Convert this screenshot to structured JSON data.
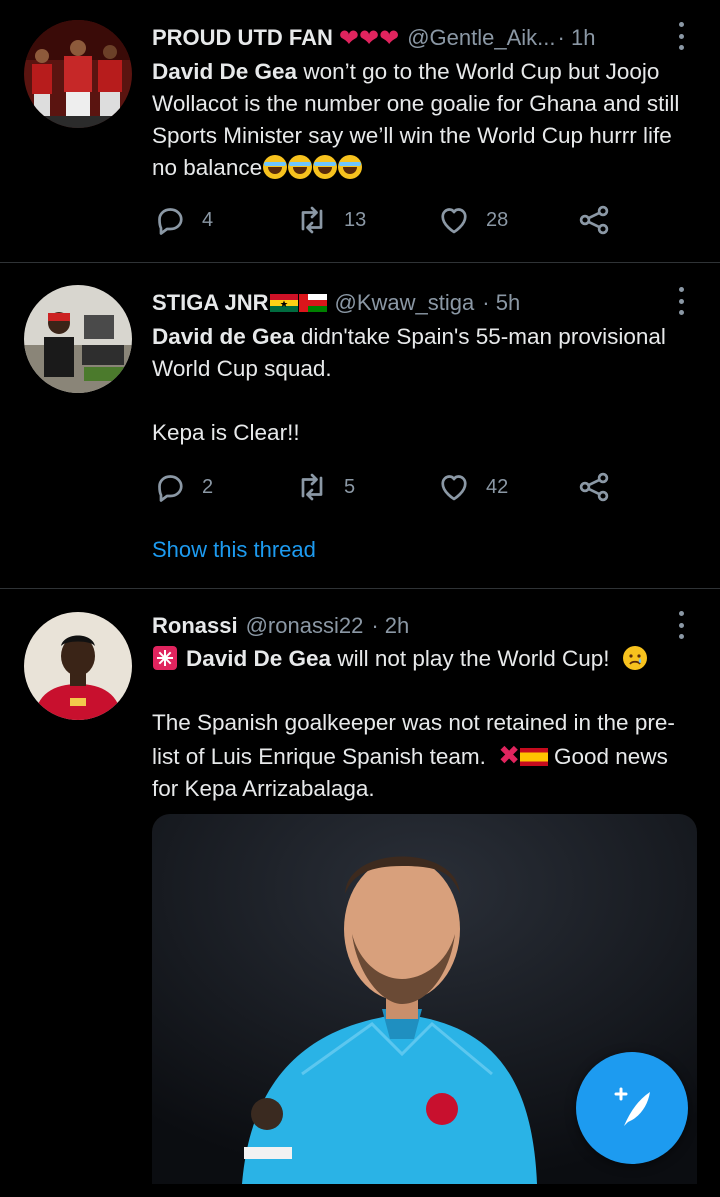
{
  "tweets": [
    {
      "name": "PROUD UTD FAN",
      "handle": "@Gentle_Aik...",
      "time": "· 1h",
      "text_bold": "David De Gea",
      "text": " won’t go to the World Cup but Joojo Wollacot is the number one goalie for Ghana and still Sports Minister say we’ll win the World Cup hurrr life no balance",
      "counts": {
        "reply": "4",
        "retweet": "13",
        "like": "28"
      }
    },
    {
      "name": "STIGA JNR",
      "handle": "@Kwaw_stiga",
      "time": "· 5h",
      "text_bold": "David de Gea",
      "text": " didn'take  Spain's 55-man provisional World Cup squad.",
      "text2": "Kepa is Clear!!",
      "counts": {
        "reply": "2",
        "retweet": "5",
        "like": "42"
      },
      "thread_link": "Show this thread"
    },
    {
      "name": "Ronassi",
      "handle": "@ronassi22",
      "time": "· 2h",
      "text_bold": "David De Gea",
      "text": " will not play the World Cup!",
      "text2a": "The Spanish goalkeeper was not retained in the pre-list of Luis Enrique Spanish team.",
      "text2b": "Good news for Kepa Arrizabalaga."
    }
  ],
  "icons": {
    "reply": "reply-icon",
    "retweet": "retweet-icon",
    "like": "heart-icon",
    "share": "share-icon",
    "compose": "compose-tweet-icon",
    "more": "more-options-icon"
  },
  "colors": {
    "accent": "#1d9bf0",
    "muted": "#8b98a5",
    "background": "#000000"
  }
}
